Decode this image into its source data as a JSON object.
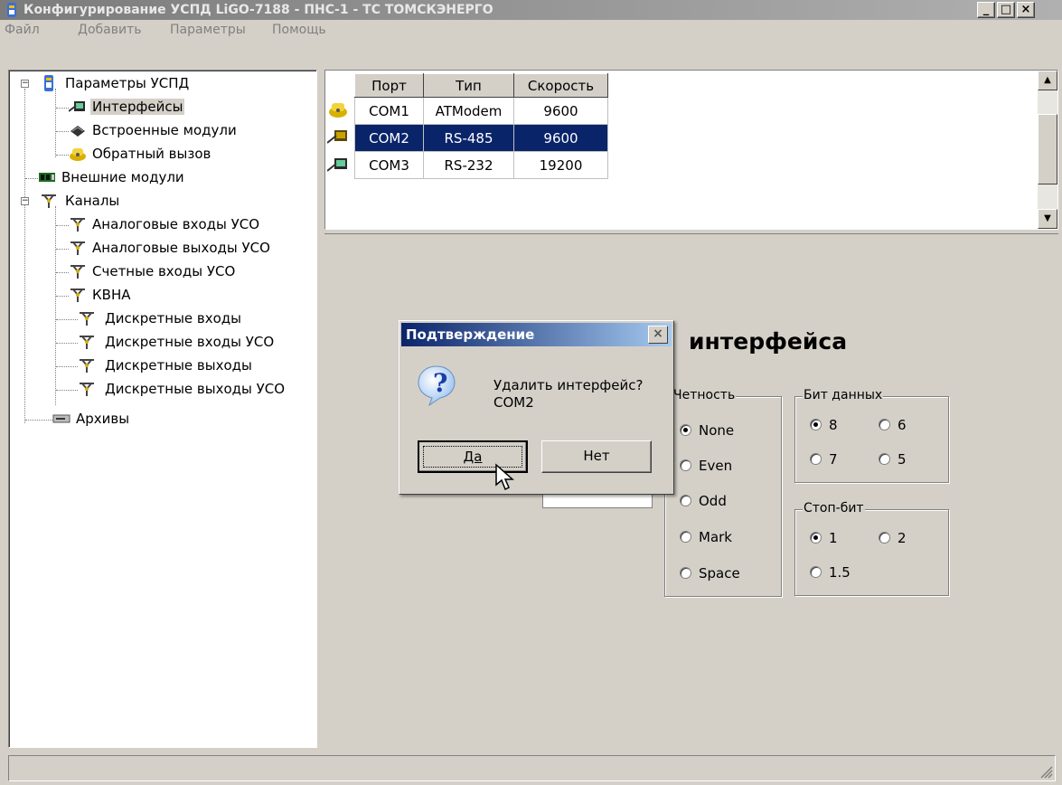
{
  "window": {
    "title": "Конфигурирование УСПД LiGO-7188 - ПНС-1 - ТС ТОМСКЭНЕРГО",
    "minimize_glyph": "_",
    "maximize_glyph": "□",
    "close_glyph": "×"
  },
  "menu": [
    "Файл",
    "Добавить",
    "Параметры",
    "Помощь"
  ],
  "tree": {
    "root": "Параметры УСПД",
    "interfaces": "Интерфейсы",
    "builtin_modules": "Встроенные модули",
    "callback": "Обратный вызов",
    "external_modules": "Внешние модули",
    "channels": "Каналы",
    "analog_in": "Аналоговые входы УСО",
    "analog_out": "Аналоговые выходы УСО",
    "counter_in": "Счетные входы УСО",
    "kvna": "КВНА",
    "discrete_in": "Дискретные входы",
    "discrete_in_uso": "Дискретные входы УСО",
    "discrete_out": "Дискретные выходы",
    "discrete_out_uso": "Дискретные выходы УСО",
    "archives": "Архивы"
  },
  "ports_table": {
    "headers": [
      "Порт",
      "Тип",
      "Скорость"
    ],
    "rows": [
      {
        "port": "COM1",
        "type": "ATModem",
        "speed": "9600"
      },
      {
        "port": "COM2",
        "type": "RS-485",
        "speed": "9600"
      },
      {
        "port": "COM3",
        "type": "RS-232",
        "speed": "19200"
      }
    ],
    "selected_row": 1
  },
  "form": {
    "heading": "интерфейса",
    "parity": {
      "title": "Четность",
      "options": [
        "None",
        "Even",
        "Odd",
        "Mark",
        "Space"
      ],
      "selected": "None"
    },
    "data_bits": {
      "title": "Бит данных",
      "options": [
        "8",
        "6",
        "7",
        "5"
      ],
      "selected": "8"
    },
    "stop_bits": {
      "title": "Стоп-бит",
      "options": [
        "1",
        "2",
        "1.5"
      ],
      "selected": "1"
    }
  },
  "dialog": {
    "title": "Подтверждение",
    "message_line1": "Удалить интерфейс?",
    "message_line2": "COM2",
    "yes_label": "Да",
    "no_label": "Нет",
    "close_glyph": "×",
    "question_glyph": "?"
  },
  "colors": {
    "selection": "#0a246a",
    "window_bg": "#d4d0c8",
    "title_gradient_start": "#0a246a"
  }
}
